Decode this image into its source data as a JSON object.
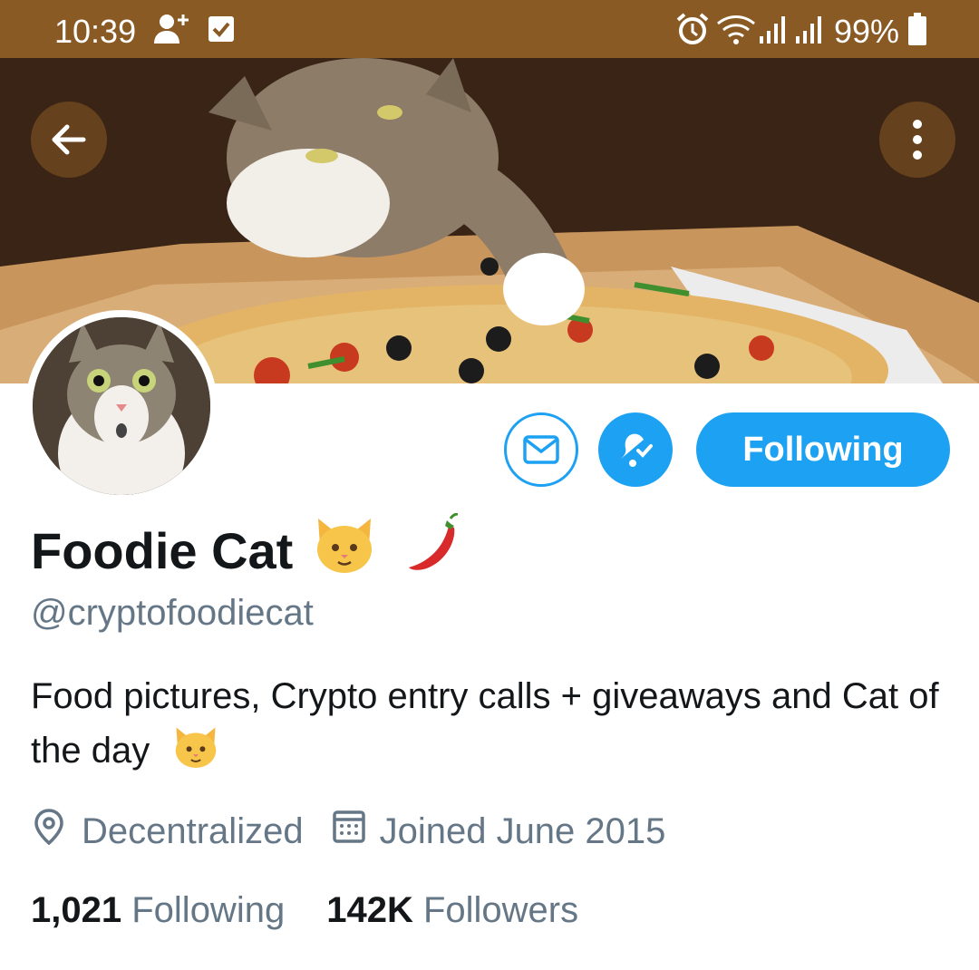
{
  "status_bar": {
    "time": "10:39",
    "battery": "99%",
    "icons": [
      "person-add-icon",
      "checkbox-icon",
      "alarm-icon",
      "wifi-icon",
      "signal-icon",
      "signal-icon",
      "battery-icon"
    ]
  },
  "header": {
    "back_icon": "arrow-left-icon",
    "more_icon": "more-vertical-icon"
  },
  "actions": {
    "message_icon": "mail-icon",
    "notify_icon": "bell-check-icon",
    "follow_label": "Following"
  },
  "profile": {
    "name": "Foodie Cat",
    "name_emojis": [
      "cat-face-emoji",
      "chili-pepper-emoji"
    ],
    "handle": "@cryptofoodiecat",
    "bio": "Food pictures, Crypto entry calls + giveaways and Cat of the day",
    "bio_emoji": "cat-face-emoji",
    "location": "Decentralized",
    "joined": "Joined June 2015"
  },
  "stats": {
    "following_count": "1,021",
    "following_label": "Following",
    "followers_count": "142K",
    "followers_label": "Followers"
  },
  "colors": {
    "status_bar": "#8a5a24",
    "accent": "#1da1f2",
    "text_primary": "#14171a",
    "text_secondary": "#657786"
  }
}
